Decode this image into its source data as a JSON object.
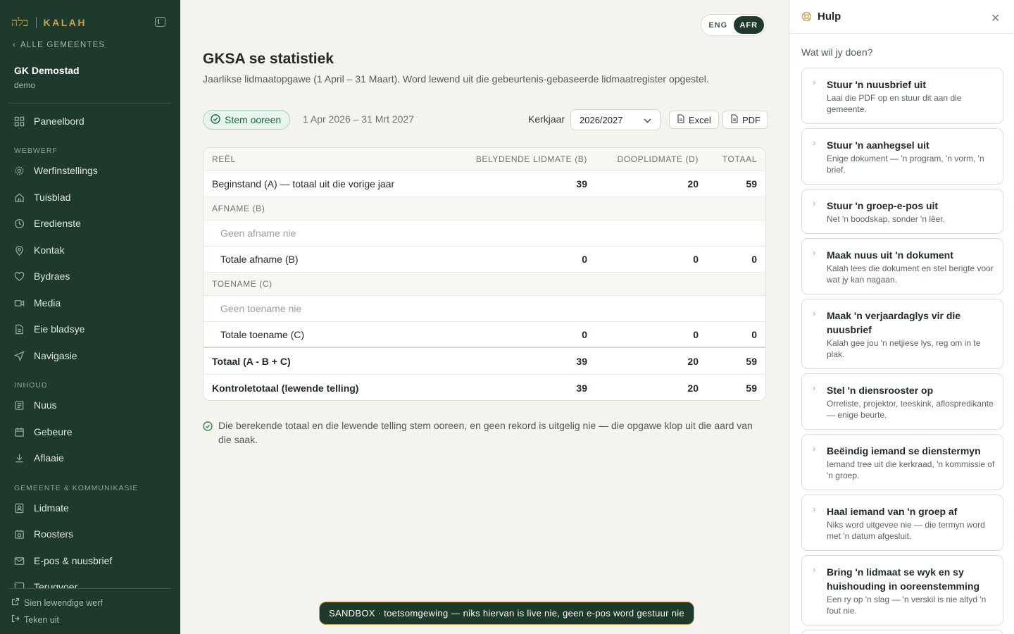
{
  "sidebar": {
    "brand_hebrew": "כלה",
    "brand_name": "KALAH",
    "back_link": "ALLE GEMEENTES",
    "church_name": "GK Demostad",
    "church_slug": "demo",
    "top_item": {
      "label": "Paneelbord",
      "icon": "dashboard-icon"
    },
    "sections": [
      {
        "title": "WEBWERF",
        "items": [
          {
            "label": "Werfinstellings",
            "icon": "gear-icon"
          },
          {
            "label": "Tuisblad",
            "icon": "home-icon"
          },
          {
            "label": "Eredienste",
            "icon": "clock-icon"
          },
          {
            "label": "Kontak",
            "icon": "map-pin-icon"
          },
          {
            "label": "Bydraes",
            "icon": "heart-icon"
          },
          {
            "label": "Media",
            "icon": "video-icon"
          },
          {
            "label": "Eie bladsye",
            "icon": "page-icon"
          },
          {
            "label": "Navigasie",
            "icon": "send-icon"
          }
        ]
      },
      {
        "title": "INHOUD",
        "items": [
          {
            "label": "Nuus",
            "icon": "newspaper-icon"
          },
          {
            "label": "Gebeure",
            "icon": "calendar-icon"
          },
          {
            "label": "Aflaaie",
            "icon": "download-icon"
          }
        ]
      },
      {
        "title": "GEMEENTE & KOMMUNIKASIE",
        "items": [
          {
            "label": "Lidmate",
            "icon": "contact-icon"
          },
          {
            "label": "Roosters",
            "icon": "roster-icon"
          },
          {
            "label": "E-pos & nuusbrief",
            "icon": "mail-icon"
          },
          {
            "label": "Terugvoer",
            "icon": "feedback-icon"
          }
        ]
      }
    ],
    "bottom_links": [
      "Sien lewendige werf",
      "Teken uit"
    ]
  },
  "lang": {
    "eng": "ENG",
    "afr": "AFR",
    "active": "AFR"
  },
  "page": {
    "title": "GKSA se statistiek",
    "subtitle": "Jaarlikse lidmaatopgawe (1 April – 31 Maart). Word lewend uit die gebeurtenis-gebaseerde lidmaatregister opgestel.",
    "status": "Stem ooreen",
    "period": "1 Apr 2026 – 31 Mrt 2027",
    "year_label": "Kerkjaar",
    "year_value": "2026/2027",
    "excel": "Excel",
    "pdf": "PDF",
    "note": "Die berekende totaal en die lewende telling stem ooreen, en geen rekord is uitgelig nie — die opgawe klop uit die aard van die saak."
  },
  "table": {
    "headers": [
      "REËL",
      "BELYDENDE LIDMATE (B)",
      "DOOPLIDMATE (D)",
      "TOTAAL"
    ],
    "rows": [
      {
        "label": "Beginstand (A) — totaal uit die vorige jaar",
        "b": "39",
        "d": "20",
        "t": "59"
      },
      {
        "label": "AFNAME (B)"
      },
      {
        "label": "Geen afname nie"
      },
      {
        "label": "Totale afname (B)",
        "b": "0",
        "d": "0",
        "t": "0"
      },
      {
        "label": "TOENAME (C)"
      },
      {
        "label": "Geen toename nie"
      },
      {
        "label": "Totale toename (C)",
        "b": "0",
        "d": "0",
        "t": "0"
      },
      {
        "label": "Totaal (A - B + C)",
        "b": "39",
        "d": "20",
        "t": "59"
      },
      {
        "label": "Kontroletotaal (lewende telling)",
        "b": "39",
        "d": "20",
        "t": "59"
      }
    ]
  },
  "help": {
    "title": "Hulp",
    "question": "Wat wil jy doen?",
    "cards": [
      {
        "title": "Stuur 'n nuusbrief uit",
        "desc": "Laai die PDF op en stuur dit aan die gemeente."
      },
      {
        "title": "Stuur 'n aanhegsel uit",
        "desc": "Enige dokument — 'n program, 'n vorm, 'n brief."
      },
      {
        "title": "Stuur 'n groep-e-pos uit",
        "desc": "Net 'n boodskap, sonder 'n lêer."
      },
      {
        "title": "Maak nuus uit 'n dokument",
        "desc": "Kalah lees die dokument en stel berigte voor wat jy kan nagaan."
      },
      {
        "title": "Maak 'n verjaardaglys vir die nuusbrief",
        "desc": "Kalah gee jou 'n netjiese lys, reg om in te plak."
      },
      {
        "title": "Stel 'n diensrooster op",
        "desc": "Orreliste, projektor, teeskink, aflospredikante — enige beurte."
      },
      {
        "title": "Beëindig iemand se dienstermyn",
        "desc": "Iemand tree uit die kerkraad, 'n kommissie of 'n groep."
      },
      {
        "title": "Haal iemand van 'n groep af",
        "desc": "Niks word uitgevee nie — die termyn word met 'n datum afgesluit."
      },
      {
        "title": "Bring 'n lidmaat se wyk en sy huishouding in ooreenstemming",
        "desc": "Een ry op 'n slag — 'n verskil is nie altyd 'n fout nie."
      }
    ]
  },
  "sandbox": "SANDBOX · toetsomgewing — niks hiervan is live nie, geen e-pos word gestuur nie",
  "colors": {
    "sidebar": "#1e3a2c",
    "accent": "#c9a24a",
    "success": "#1e6b42",
    "page_bg": "#f5f3ee"
  }
}
